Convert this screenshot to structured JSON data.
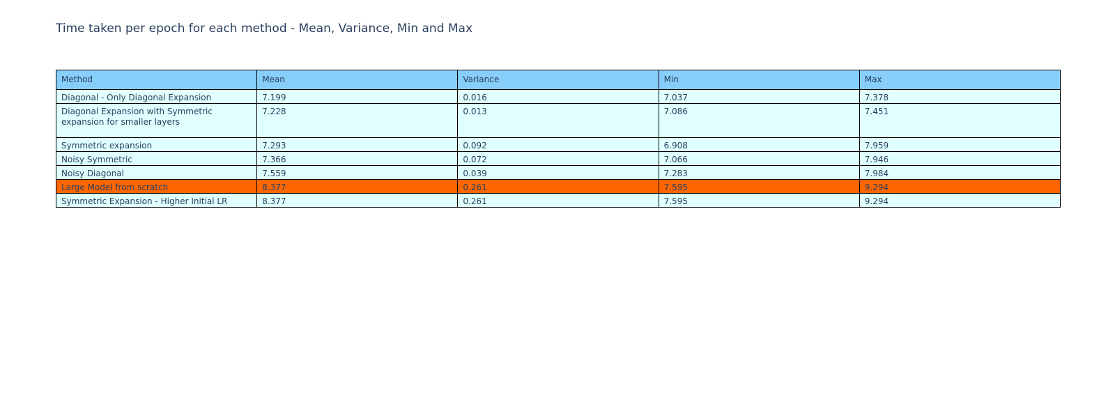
{
  "chart_data": {
    "type": "table",
    "title": "Time taken per epoch for each method - Mean, Variance, Min and Max",
    "columns": [
      "Method",
      "Mean",
      "Variance",
      "Min",
      "Max"
    ],
    "rows": [
      [
        "Diagonal - Only Diagonal Expansion",
        "7.199",
        "0.016",
        "7.037",
        "7.378"
      ],
      [
        "Diagonal Expansion with Symmetric expansion for smaller layers",
        "7.228",
        "0.013",
        "7.086",
        "7.451"
      ],
      [
        "Symmetric expansion",
        "7.293",
        "0.092",
        "6.908",
        "7.959"
      ],
      [
        "Noisy Symmetric",
        "7.366",
        "0.072",
        "7.066",
        "7.946"
      ],
      [
        "Noisy Diagonal",
        "7.559",
        "0.039",
        "7.283",
        "7.984"
      ],
      [
        "Large Model from scratch",
        "8.377",
        "0.261",
        "7.595",
        "9.294"
      ],
      [
        "Symmetric Expansion - Higher Initial LR",
        "8.377",
        "0.261",
        "7.595",
        "9.294"
      ]
    ],
    "highlighted_row": 5,
    "colors": {
      "header_fill": "#87cefa",
      "cell_fill": "#e0ffff",
      "highlight_fill": "#ff6600",
      "line": "#000000",
      "text": "#2a3f5f"
    }
  }
}
